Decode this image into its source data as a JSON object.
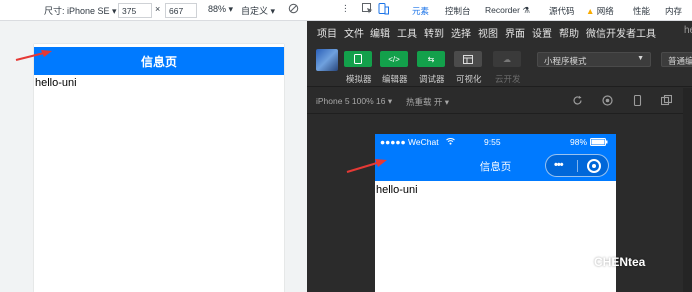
{
  "devtools": {
    "size_label": "尺寸: iPhone SE",
    "width": "375",
    "times": "×",
    "height": "667",
    "zoom": "88%",
    "custom": "自定义"
  },
  "web_page": {
    "navbar_title": "信息页",
    "content": "hello-uni"
  },
  "browser_tabs": {
    "elements": "元素",
    "console": "控制台",
    "recorder": "Recorder",
    "sources": "源代码",
    "network": "网络",
    "performance": "性能",
    "memory": "内存"
  },
  "wechat_devtools": {
    "menu": [
      "项目",
      "文件",
      "编辑",
      "工具",
      "转到",
      "选择",
      "视图",
      "界面",
      "设置",
      "帮助",
      "微信开发者工具"
    ],
    "menu_extra": "he",
    "toolbar": {
      "simulator": "模拟器",
      "editor": "编辑器",
      "debugger": "调试器",
      "visualize": "可视化",
      "cloud": "云开发",
      "mode": "小程序模式",
      "compile": "普通编"
    },
    "sim_bar": {
      "device": "iPhone 5 100% 16",
      "hot_reload": "热重载 开"
    },
    "phone": {
      "carrier": "●●●●● WeChat",
      "time": "9:55",
      "battery": "98%",
      "navbar_title": "信息页",
      "content": "hello-uni"
    }
  },
  "watermark": "CHENtea",
  "colors": {
    "navbar_blue": "#007aff",
    "arrow_red": "#e53935",
    "toolbar_green": "#13a04b"
  }
}
